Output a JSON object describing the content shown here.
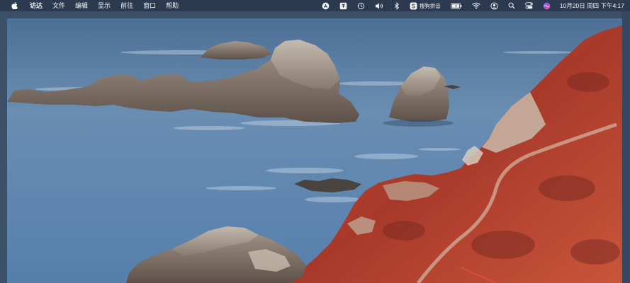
{
  "menubar": {
    "apple_icon": "apple-logo-icon",
    "items": [
      "访达",
      "文件",
      "编辑",
      "显示",
      "前往",
      "窗口",
      "帮助"
    ],
    "status": {
      "input_method_label": "搜狗拼音",
      "clock": "10月20日 周四 下午4:17"
    },
    "status_icons": [
      "app-store-icon",
      "input-method-icon",
      "time-machine-icon",
      "volume-icon",
      "bluetooth-icon",
      "sogou-icon",
      "battery-icon",
      "wifi-icon",
      "user-icon",
      "search-icon",
      "control-center-icon",
      "siri-icon"
    ]
  },
  "desktop": {
    "wallpaper": "coastal-rocks-wallpaper"
  },
  "colors": {
    "menubar_bg": "#2c3a4e",
    "sea": "#5f86ad",
    "cliff_red": "#b8422b",
    "rock": "#8d7f72"
  }
}
